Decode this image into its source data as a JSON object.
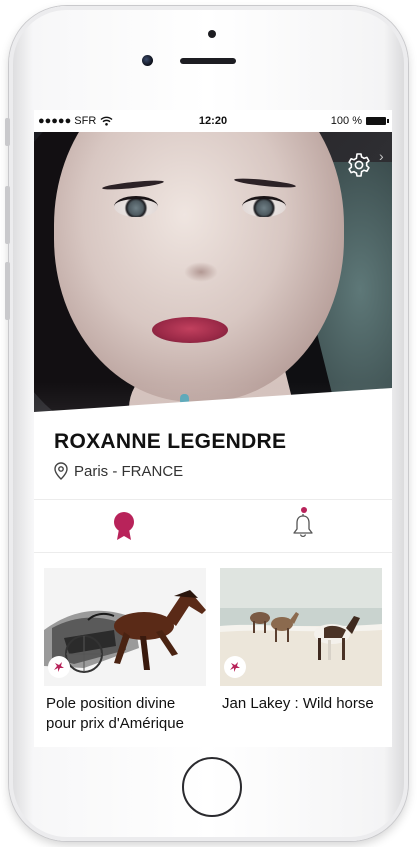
{
  "status_bar": {
    "carrier": "●●●●● SFR",
    "time": "12:20",
    "battery": "100 %"
  },
  "profile": {
    "name": "ROXANNE LEGENDRE",
    "location": "Paris - FRANCE"
  },
  "tabs": [
    {
      "icon": "award-ribbon-icon",
      "active": true
    },
    {
      "icon": "bell-icon",
      "active": false,
      "has_notification": true
    }
  ],
  "colors": {
    "accent": "#b8235a",
    "text": "#111111"
  },
  "cards": [
    {
      "title": "Pole position divine pour prix d'Amérique",
      "tag_icon": "pegasus-icon"
    },
    {
      "title": "Jan Lakey : Wild horse",
      "tag_icon": "pegasus-icon"
    }
  ]
}
